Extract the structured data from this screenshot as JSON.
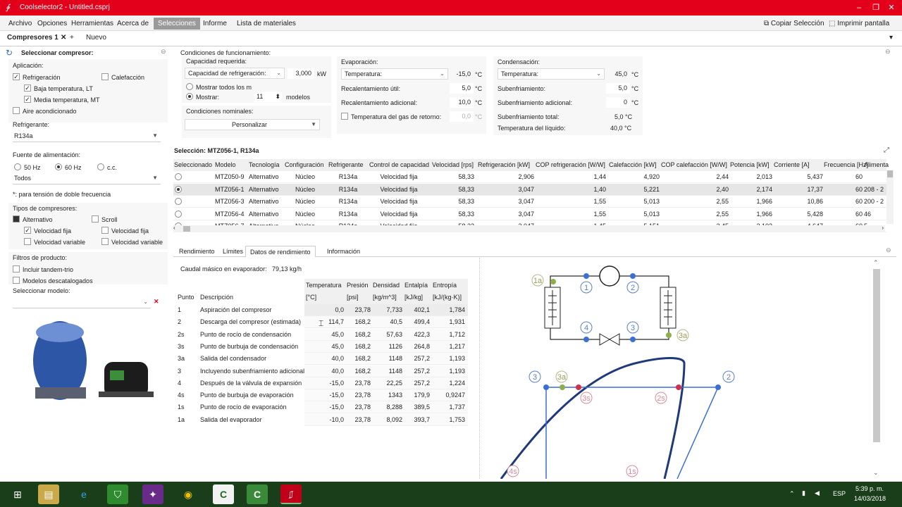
{
  "window": {
    "title": "Coolselector2 - Untitled.csprj",
    "logo": "∲"
  },
  "menu": [
    "Archivo",
    "Opciones",
    "Herramientas",
    "Acerca de",
    "Selecciones",
    "Informe",
    "Lista de materiales"
  ],
  "menu_active": "Selecciones",
  "toolbar_right": {
    "copy": "Copiar Selección",
    "print": "Imprimir pantalla"
  },
  "doc_tabs": {
    "active": "Compresores 1",
    "new": "Nuevo"
  },
  "left": {
    "heading": "Seleccionar compresor:",
    "aplicacion": "Aplicación:",
    "refrigeracion": "Refrigeración",
    "calefaccion": "Calefacción",
    "baja_temp": "Baja temperatura, LT",
    "media_temp": "Media temperatura, MT",
    "aire": "Aire acondicionado",
    "refrigerante_lbl": "Refrigerante:",
    "refrigerante_val": "R134a",
    "fuente_lbl": "Fuente de alimentación:",
    "hz50": "50 Hz",
    "hz60": "60 Hz",
    "cc": "c.c.",
    "todos": "Todos",
    "nota": "*: para tensión de doble frecuencia",
    "tipos_lbl": "Tipos de compresores:",
    "alternativo": "Alternativo",
    "scroll": "Scroll",
    "vel_fija": "Velocidad fija",
    "vel_var": "Velocidad variable",
    "vel_fija2": "Velocidad fija",
    "vel_var2": "Velocidad variable",
    "filtros_lbl": "Filtros de producto:",
    "tandem": "Incluir tandem-trio",
    "descat": "Modelos descatalogados",
    "sel_modelo": "Seleccionar modelo:"
  },
  "conditions": {
    "heading": "Condiciones de funcionamiento:",
    "capacidad_lbl": "Capacidad requerida:",
    "capacidad_combo": "Capacidad de refrigeración:",
    "capacidad_val": "3,000",
    "capacidad_unit": "kW",
    "mostrar_todos": "Mostrar todos los m",
    "mostrar": "Mostrar:",
    "mostrar_n": "11",
    "modelos": "modelos",
    "nominales_lbl": "Condiciones nominales:",
    "personalizar": "Personalizar"
  },
  "evaporacion": {
    "heading": "Evaporación:",
    "combo": "Temperatura:",
    "temp": "-15,0",
    "temp_u": "°C",
    "recal_util": "Recalentamiento útil:",
    "recal_util_v": "5,0",
    "recal_ad": "Recalentamiento adicional:",
    "recal_ad_v": "10,0",
    "gas_ret": "Temperatura del gas de retorno:",
    "gas_ret_v": "0,0",
    "u": "°C"
  },
  "condensacion": {
    "heading": "Condensación:",
    "combo": "Temperatura:",
    "temp": "45,0",
    "sub": "Subenfriamiento:",
    "sub_v": "5,0",
    "sub_ad": "Subenfriamiento adicional:",
    "sub_ad_v": "0",
    "sub_tot": "Subenfriamiento total:",
    "sub_tot_v": "5,0 °C",
    "t_liq": "Temperatura del líquido:",
    "t_liq_v": "40,0 °C",
    "u": "°C"
  },
  "selection_title": "Selección: MTZ056-1, R134a",
  "grid": {
    "headers": [
      "Seleccionado",
      "Modelo",
      "Tecnología",
      "Configuración",
      "Refrigerante",
      "Control de capacidad",
      "Velocidad [rps]",
      "Refrigeración [kW]",
      "COP refrigeración [W/W]",
      "Calefacción [kW]",
      "COP calefacción [W/W]",
      "Potencia [kW]",
      "Corriente [A]",
      "Frecuencia [Hz]",
      "Alimenta"
    ],
    "rows": [
      [
        "",
        "MTZ050-9",
        "Alternativo",
        "Núcleo",
        "R134a",
        "Velocidad fija",
        "58,33",
        "2,906",
        "1,44",
        "4,920",
        "2,44",
        "2,013",
        "5,437",
        "60",
        ""
      ],
      [
        "",
        "MTZ056-1",
        "Alternativo",
        "Núcleo",
        "R134a",
        "Velocidad fija",
        "58,33",
        "3,047",
        "1,40",
        "5,221",
        "2,40",
        "2,174",
        "17,37",
        "60",
        "208 - 2"
      ],
      [
        "",
        "MTZ056-3",
        "Alternativo",
        "Núcleo",
        "R134a",
        "Velocidad fija",
        "58,33",
        "3,047",
        "1,55",
        "5,013",
        "2,55",
        "1,966",
        "10,86",
        "60",
        "200 - 2"
      ],
      [
        "",
        "MTZ056-4",
        "Alternativo",
        "Núcleo",
        "R134a",
        "Velocidad fija",
        "58,33",
        "3,047",
        "1,55",
        "5,013",
        "2,55",
        "1,966",
        "5,428",
        "60",
        "46"
      ],
      [
        "",
        "MTZ056-7",
        "Alternativo",
        "Núcleo",
        "R134a",
        "Velocidad fija",
        "58,33",
        "3,047",
        "1,45",
        "5,151",
        "2,45",
        "2,103",
        "4,647",
        "60",
        "5"
      ]
    ],
    "selected_index": 1
  },
  "lower_tabs": [
    "Rendimiento",
    "Límites",
    "Datos de rendimiento",
    "Información"
  ],
  "lower_tab_active": "Datos de rendimiento",
  "caudal": {
    "label": "Caudal másico en evaporador:",
    "value": "79,13 kg/h"
  },
  "perf": {
    "headers_top": [
      "Temperatura",
      "Presión",
      "Densidad",
      "Entalpía",
      "Entropía"
    ],
    "headers_bottom": [
      "Punto",
      "Descripción",
      "[°C]",
      "[psi]",
      "[kg/m^3]",
      "[kJ/kg]",
      "[kJ/(kg·K)]"
    ],
    "rows": [
      [
        "1",
        "Aspiración del compresor",
        "0,0",
        "23,78",
        "7,733",
        "402,1",
        "1,784"
      ],
      [
        "2",
        "Descarga del compresor (estimada)",
        "114,7",
        "168,2",
        "40,5",
        "499,4",
        "1,931"
      ],
      [
        "2s",
        "Punto de rocío de condensación",
        "45,0",
        "168,2",
        "57,63",
        "422,3",
        "1,712"
      ],
      [
        "3s",
        "Punto de burbuja de condensación",
        "45,0",
        "168,2",
        "1126",
        "264,8",
        "1,217"
      ],
      [
        "3a",
        "Salida del condensador",
        "40,0",
        "168,2",
        "1148",
        "257,2",
        "1,193"
      ],
      [
        "3",
        "Incluyendo subenfriamiento adicional",
        "40,0",
        "168,2",
        "1148",
        "257,2",
        "1,193"
      ],
      [
        "4",
        "Después de la válvula de expansión",
        "-15,0",
        "23,78",
        "22,25",
        "257,2",
        "1,224"
      ],
      [
        "4s",
        "Punto de burbuja de evaporación",
        "-15,0",
        "23,78",
        "1343",
        "179,9",
        "0,9247"
      ],
      [
        "1s",
        "Punto de rocío de evaporación",
        "-15,0",
        "23,78",
        "8,288",
        "389,5",
        "1,737"
      ],
      [
        "1a",
        "Salida del evaporador",
        "-10,0",
        "23,78",
        "8,092",
        "393,7",
        "1,753"
      ]
    ]
  },
  "diagram_labels": [
    "1a",
    "1",
    "2",
    "4",
    "3",
    "3a",
    "3",
    "3a",
    "2",
    "3s",
    "2s",
    "4s",
    "1s"
  ],
  "tray": {
    "lang": "ESP",
    "time": "5:39 p. m.",
    "date": "14/03/2018"
  }
}
